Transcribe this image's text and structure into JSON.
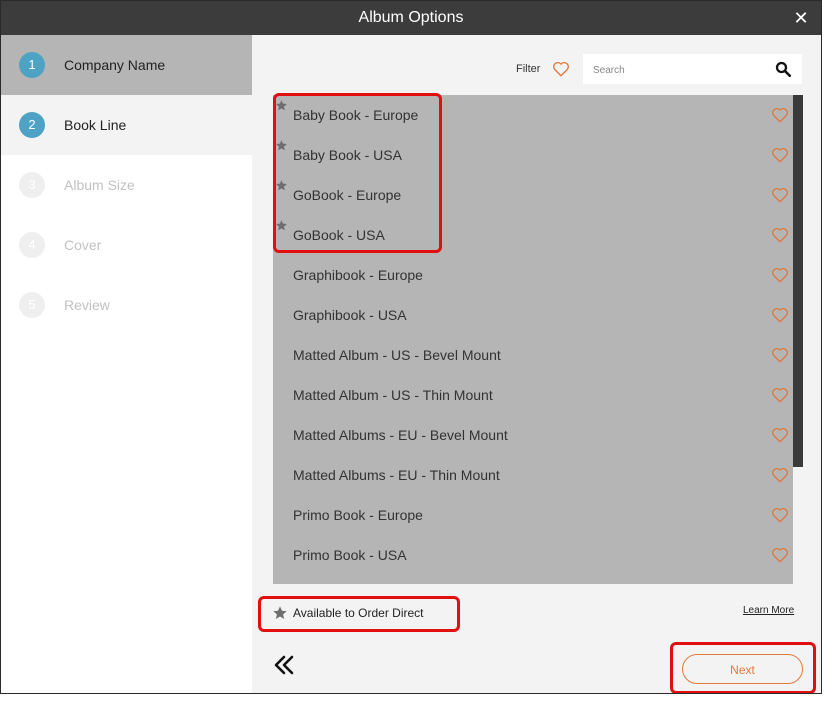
{
  "window": {
    "title": "Album Options",
    "close_icon": "close-icon"
  },
  "steps": [
    {
      "number": "1",
      "label": "Company Name",
      "state": "active"
    },
    {
      "number": "2",
      "label": "Book Line",
      "state": "current"
    },
    {
      "number": "3",
      "label": "Album Size",
      "state": "disabled"
    },
    {
      "number": "4",
      "label": "Cover",
      "state": "disabled"
    },
    {
      "number": "5",
      "label": "Review",
      "state": "disabled"
    }
  ],
  "toolbar": {
    "filter_label": "Filter",
    "search_placeholder": "Search",
    "search_value": ""
  },
  "book_lines": [
    {
      "name": "Baby Book - Europe",
      "order_direct": true
    },
    {
      "name": "Baby Book - USA",
      "order_direct": true
    },
    {
      "name": "GoBook - Europe",
      "order_direct": true
    },
    {
      "name": "GoBook - USA",
      "order_direct": true
    },
    {
      "name": "Graphibook - Europe",
      "order_direct": false
    },
    {
      "name": "Graphibook - USA",
      "order_direct": false
    },
    {
      "name": "Matted Album - US - Bevel Mount",
      "order_direct": false
    },
    {
      "name": "Matted Album - US - Thin Mount",
      "order_direct": false
    },
    {
      "name": "Matted Albums - EU - Bevel Mount",
      "order_direct": false
    },
    {
      "name": "Matted Albums - EU - Thin Mount",
      "order_direct": false
    },
    {
      "name": "Primo Book - Europe",
      "order_direct": false
    },
    {
      "name": "Primo Book - USA",
      "order_direct": false
    }
  ],
  "legend": {
    "label": "Available to Order Direct"
  },
  "footer": {
    "learn_more": "Learn More",
    "next_label": "Next"
  },
  "colors": {
    "accent": "#e07a3e",
    "step_active": "#4ea3c5",
    "highlight": "#e01010",
    "titlebar": "#3c3c3c"
  }
}
